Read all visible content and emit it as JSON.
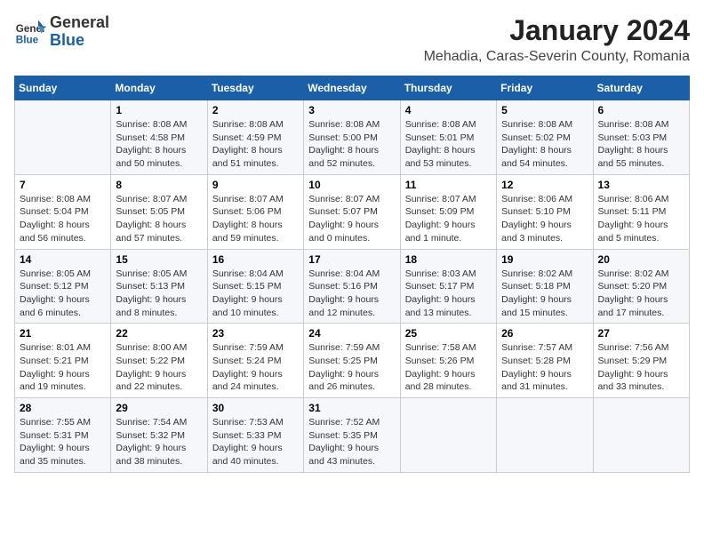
{
  "logo": {
    "general": "General",
    "blue": "Blue"
  },
  "title": {
    "month_year": "January 2024",
    "location": "Mehadia, Caras-Severin County, Romania"
  },
  "days_of_week": [
    "Sunday",
    "Monday",
    "Tuesday",
    "Wednesday",
    "Thursday",
    "Friday",
    "Saturday"
  ],
  "weeks": [
    [
      {
        "day": "",
        "sunrise": "",
        "sunset": "",
        "daylight": ""
      },
      {
        "day": "1",
        "sunrise": "Sunrise: 8:08 AM",
        "sunset": "Sunset: 4:58 PM",
        "daylight": "Daylight: 8 hours and 50 minutes."
      },
      {
        "day": "2",
        "sunrise": "Sunrise: 8:08 AM",
        "sunset": "Sunset: 4:59 PM",
        "daylight": "Daylight: 8 hours and 51 minutes."
      },
      {
        "day": "3",
        "sunrise": "Sunrise: 8:08 AM",
        "sunset": "Sunset: 5:00 PM",
        "daylight": "Daylight: 8 hours and 52 minutes."
      },
      {
        "day": "4",
        "sunrise": "Sunrise: 8:08 AM",
        "sunset": "Sunset: 5:01 PM",
        "daylight": "Daylight: 8 hours and 53 minutes."
      },
      {
        "day": "5",
        "sunrise": "Sunrise: 8:08 AM",
        "sunset": "Sunset: 5:02 PM",
        "daylight": "Daylight: 8 hours and 54 minutes."
      },
      {
        "day": "6",
        "sunrise": "Sunrise: 8:08 AM",
        "sunset": "Sunset: 5:03 PM",
        "daylight": "Daylight: 8 hours and 55 minutes."
      }
    ],
    [
      {
        "day": "7",
        "sunrise": "Sunrise: 8:08 AM",
        "sunset": "Sunset: 5:04 PM",
        "daylight": "Daylight: 8 hours and 56 minutes."
      },
      {
        "day": "8",
        "sunrise": "Sunrise: 8:07 AM",
        "sunset": "Sunset: 5:05 PM",
        "daylight": "Daylight: 8 hours and 57 minutes."
      },
      {
        "day": "9",
        "sunrise": "Sunrise: 8:07 AM",
        "sunset": "Sunset: 5:06 PM",
        "daylight": "Daylight: 8 hours and 59 minutes."
      },
      {
        "day": "10",
        "sunrise": "Sunrise: 8:07 AM",
        "sunset": "Sunset: 5:07 PM",
        "daylight": "Daylight: 9 hours and 0 minutes."
      },
      {
        "day": "11",
        "sunrise": "Sunrise: 8:07 AM",
        "sunset": "Sunset: 5:09 PM",
        "daylight": "Daylight: 9 hours and 1 minute."
      },
      {
        "day": "12",
        "sunrise": "Sunrise: 8:06 AM",
        "sunset": "Sunset: 5:10 PM",
        "daylight": "Daylight: 9 hours and 3 minutes."
      },
      {
        "day": "13",
        "sunrise": "Sunrise: 8:06 AM",
        "sunset": "Sunset: 5:11 PM",
        "daylight": "Daylight: 9 hours and 5 minutes."
      }
    ],
    [
      {
        "day": "14",
        "sunrise": "Sunrise: 8:05 AM",
        "sunset": "Sunset: 5:12 PM",
        "daylight": "Daylight: 9 hours and 6 minutes."
      },
      {
        "day": "15",
        "sunrise": "Sunrise: 8:05 AM",
        "sunset": "Sunset: 5:13 PM",
        "daylight": "Daylight: 9 hours and 8 minutes."
      },
      {
        "day": "16",
        "sunrise": "Sunrise: 8:04 AM",
        "sunset": "Sunset: 5:15 PM",
        "daylight": "Daylight: 9 hours and 10 minutes."
      },
      {
        "day": "17",
        "sunrise": "Sunrise: 8:04 AM",
        "sunset": "Sunset: 5:16 PM",
        "daylight": "Daylight: 9 hours and 12 minutes."
      },
      {
        "day": "18",
        "sunrise": "Sunrise: 8:03 AM",
        "sunset": "Sunset: 5:17 PM",
        "daylight": "Daylight: 9 hours and 13 minutes."
      },
      {
        "day": "19",
        "sunrise": "Sunrise: 8:02 AM",
        "sunset": "Sunset: 5:18 PM",
        "daylight": "Daylight: 9 hours and 15 minutes."
      },
      {
        "day": "20",
        "sunrise": "Sunrise: 8:02 AM",
        "sunset": "Sunset: 5:20 PM",
        "daylight": "Daylight: 9 hours and 17 minutes."
      }
    ],
    [
      {
        "day": "21",
        "sunrise": "Sunrise: 8:01 AM",
        "sunset": "Sunset: 5:21 PM",
        "daylight": "Daylight: 9 hours and 19 minutes."
      },
      {
        "day": "22",
        "sunrise": "Sunrise: 8:00 AM",
        "sunset": "Sunset: 5:22 PM",
        "daylight": "Daylight: 9 hours and 22 minutes."
      },
      {
        "day": "23",
        "sunrise": "Sunrise: 7:59 AM",
        "sunset": "Sunset: 5:24 PM",
        "daylight": "Daylight: 9 hours and 24 minutes."
      },
      {
        "day": "24",
        "sunrise": "Sunrise: 7:59 AM",
        "sunset": "Sunset: 5:25 PM",
        "daylight": "Daylight: 9 hours and 26 minutes."
      },
      {
        "day": "25",
        "sunrise": "Sunrise: 7:58 AM",
        "sunset": "Sunset: 5:26 PM",
        "daylight": "Daylight: 9 hours and 28 minutes."
      },
      {
        "day": "26",
        "sunrise": "Sunrise: 7:57 AM",
        "sunset": "Sunset: 5:28 PM",
        "daylight": "Daylight: 9 hours and 31 minutes."
      },
      {
        "day": "27",
        "sunrise": "Sunrise: 7:56 AM",
        "sunset": "Sunset: 5:29 PM",
        "daylight": "Daylight: 9 hours and 33 minutes."
      }
    ],
    [
      {
        "day": "28",
        "sunrise": "Sunrise: 7:55 AM",
        "sunset": "Sunset: 5:31 PM",
        "daylight": "Daylight: 9 hours and 35 minutes."
      },
      {
        "day": "29",
        "sunrise": "Sunrise: 7:54 AM",
        "sunset": "Sunset: 5:32 PM",
        "daylight": "Daylight: 9 hours and 38 minutes."
      },
      {
        "day": "30",
        "sunrise": "Sunrise: 7:53 AM",
        "sunset": "Sunset: 5:33 PM",
        "daylight": "Daylight: 9 hours and 40 minutes."
      },
      {
        "day": "31",
        "sunrise": "Sunrise: 7:52 AM",
        "sunset": "Sunset: 5:35 PM",
        "daylight": "Daylight: 9 hours and 43 minutes."
      },
      {
        "day": "",
        "sunrise": "",
        "sunset": "",
        "daylight": ""
      },
      {
        "day": "",
        "sunrise": "",
        "sunset": "",
        "daylight": ""
      },
      {
        "day": "",
        "sunrise": "",
        "sunset": "",
        "daylight": ""
      }
    ]
  ]
}
